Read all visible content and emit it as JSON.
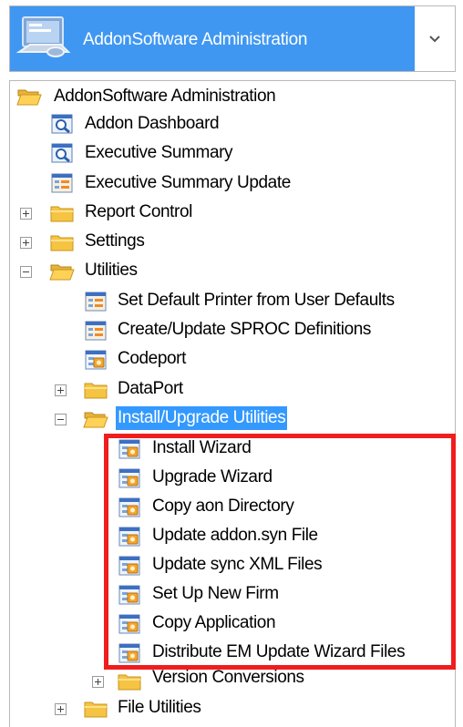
{
  "header": {
    "title": "AddonSoftware Administration",
    "accent": "#3f97f2"
  },
  "tree": {
    "root": "AddonSoftware Administration",
    "items": {
      "addon_dashboard": "Addon Dashboard",
      "executive_summary": "Executive Summary",
      "executive_summary_update": "Executive Summary Update",
      "report_control": "Report Control",
      "settings": "Settings",
      "utilities": "Utilities",
      "set_default_printer": "Set Default Printer from User Defaults",
      "create_update_sproc": "Create/Update SPROC Definitions",
      "codeport": "Codeport",
      "dataport": "DataPort",
      "install_upgrade_utilities": "Install/Upgrade Utilities",
      "install_wizard": "Install Wizard",
      "upgrade_wizard": "Upgrade Wizard",
      "copy_aon_directory": "Copy aon Directory",
      "update_addon_syn": "Update addon.syn File",
      "update_sync_xml": "Update sync XML Files",
      "set_up_new_firm": "Set Up New Firm",
      "copy_application": "Copy Application",
      "distribute_em_update": "Distribute EM Update Wizard Files",
      "version_conversions": "Version Conversions",
      "file_utilities": "File Utilities"
    }
  },
  "colors": {
    "selection": "#3399ff",
    "highlight_border": "#f01d1d"
  }
}
